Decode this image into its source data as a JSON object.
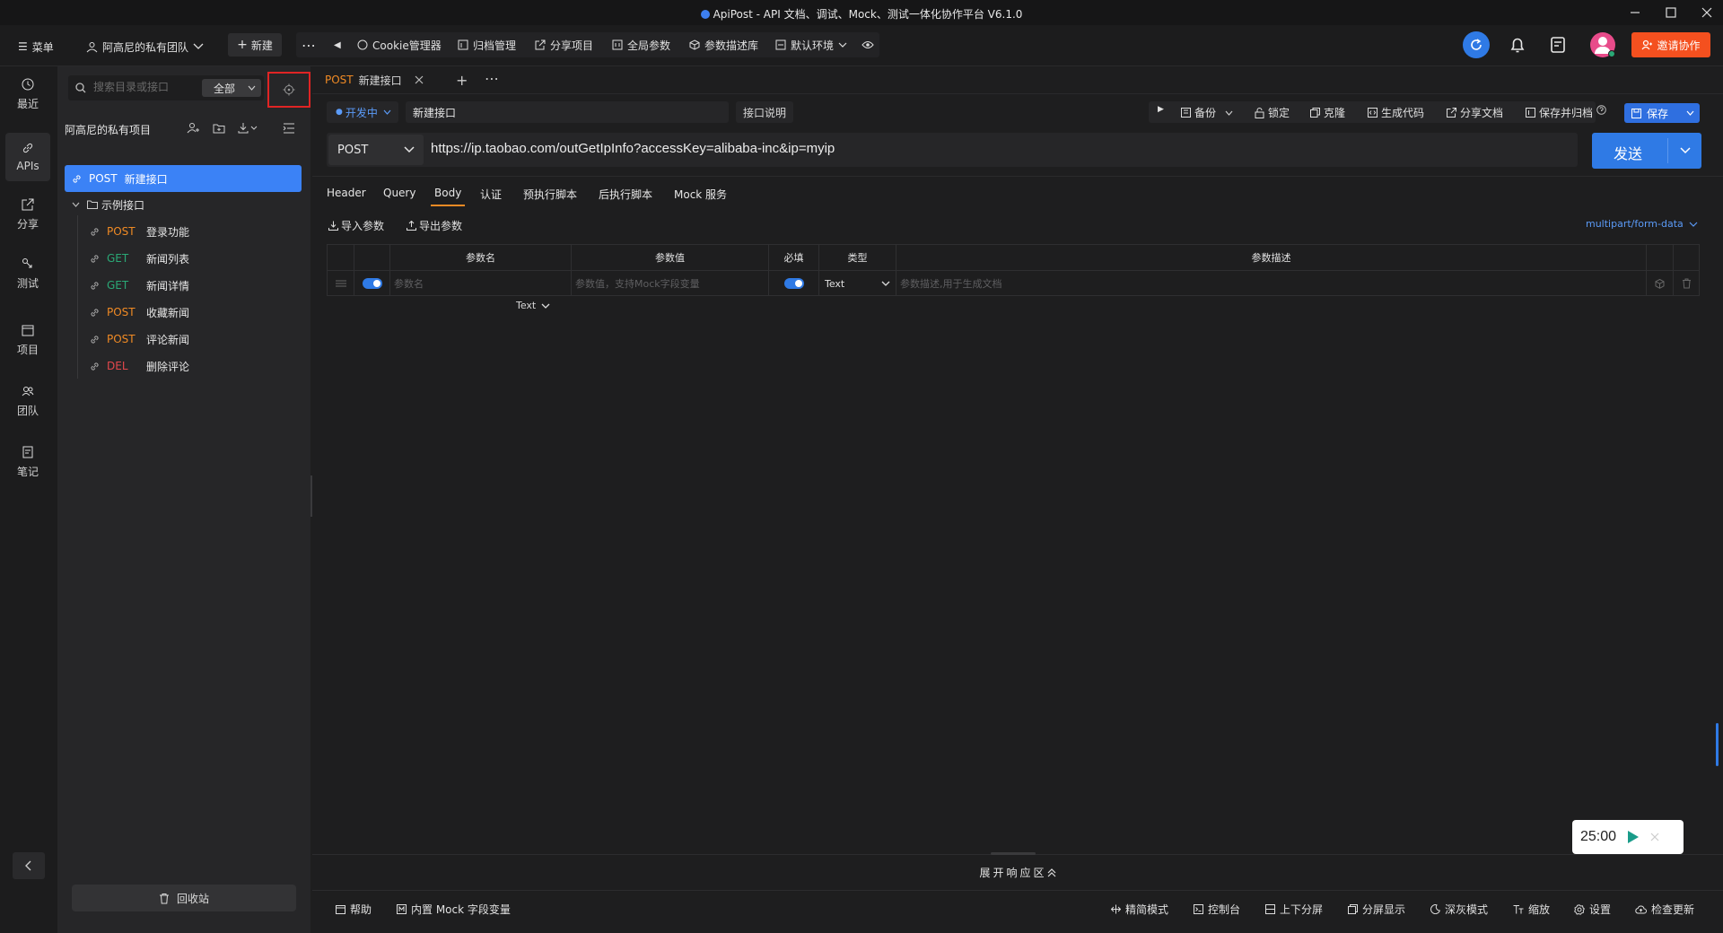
{
  "window": {
    "title": "ApiPost - API 文档、调试、Mock、测试一体化协作平台 V6.1.0"
  },
  "topbar": {
    "menu": "菜单",
    "team": "阿高尼的私有团队",
    "new": "新建",
    "cookie": "Cookie管理器",
    "archive": "归档管理",
    "share_project": "分享项目",
    "global_params": "全局参数",
    "param_library": "参数描述库",
    "env": "默认环境",
    "invite": "邀请协作"
  },
  "rail": {
    "recent": "最近",
    "apis": "APIs",
    "share": "分享",
    "test": "测试",
    "project": "项目",
    "team": "团队",
    "notes": "笔记"
  },
  "sidebar": {
    "search_placeholder": "搜索目录或接口",
    "scope": "全部",
    "project_name": "阿高尼的私有项目",
    "active": {
      "method": "POST",
      "name": "新建接口"
    },
    "folder": "示例接口",
    "items": [
      {
        "method": "POST",
        "name": "登录功能"
      },
      {
        "method": "GET",
        "name": "新闻列表"
      },
      {
        "method": "GET",
        "name": "新闻详情"
      },
      {
        "method": "POST",
        "name": "收藏新闻"
      },
      {
        "method": "POST",
        "name": "评论新闻"
      },
      {
        "method": "DEL",
        "name": "删除评论"
      }
    ],
    "recycle": "回收站"
  },
  "tab": {
    "method": "POST",
    "name": "新建接口"
  },
  "request": {
    "status": "开发中",
    "name": "新建接口",
    "desc_button": "接口说明",
    "actions": {
      "backup": "备份",
      "lock": "锁定",
      "clone": "克隆",
      "gen_code": "生成代码",
      "share_doc": "分享文档",
      "save_archive": "保存并归档",
      "save": "保存"
    },
    "method": "POST",
    "url": "https://ip.taobao.com/outGetIpInfo?accessKey=alibaba-inc&ip=myip",
    "send": "发送"
  },
  "subtabs": [
    "Header",
    "Query",
    "Body",
    "认证",
    "预执行脚本",
    "后执行脚本",
    "Mock 服务"
  ],
  "body": {
    "import": "导入参数",
    "export": "导出参数",
    "content_type": "multipart/form-data",
    "columns": {
      "name": "参数名",
      "value": "参数值",
      "required": "必填",
      "type": "类型",
      "desc": "参数描述"
    },
    "row": {
      "name_placeholder": "参数名",
      "name_type": "Text",
      "value_placeholder": "参数值，支持Mock字段变量",
      "type": "Text",
      "desc_placeholder": "参数描述,用于生成文档"
    }
  },
  "timer": "25:00",
  "response_toggle": "展开响应区",
  "statusbar": {
    "help": "帮助",
    "mock_vars": "内置 Mock 字段变量",
    "simple": "精简模式",
    "console": "控制台",
    "split": "上下分屏",
    "screen": "分屏显示",
    "dark": "深灰模式",
    "zoom": "缩放",
    "settings": "设置",
    "update": "检查更新"
  }
}
